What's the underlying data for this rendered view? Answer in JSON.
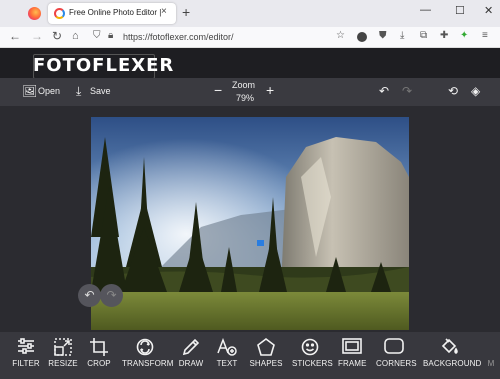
{
  "browser": {
    "tab_title": "Free Online Photo Editor | Fotof",
    "tab_close": "×",
    "new_tab": "+",
    "url": "https://fotoflexer.com/editor/",
    "window_controls": {
      "minimize": "—",
      "maximize": "☐",
      "close": "✕"
    }
  },
  "app": {
    "logo_text": "FOTOFLEXER",
    "toolbar": {
      "open_label": "Open",
      "save_label": "Save",
      "zoom_label": "Zoom",
      "zoom_value": "79%",
      "zoom_out": "−",
      "zoom_in": "+"
    },
    "tools": [
      {
        "label": "FILTER",
        "icon": "sliders-icon"
      },
      {
        "label": "RESIZE",
        "icon": "resize-icon"
      },
      {
        "label": "CROP",
        "icon": "crop-icon"
      },
      {
        "label": "TRANSFORM",
        "icon": "transform-icon"
      },
      {
        "label": "DRAW",
        "icon": "pencil-icon"
      },
      {
        "label": "TEXT",
        "icon": "text-icon"
      },
      {
        "label": "SHAPES",
        "icon": "shapes-icon"
      },
      {
        "label": "STICKERS",
        "icon": "smiley-icon"
      },
      {
        "label": "FRAME",
        "icon": "frame-icon"
      },
      {
        "label": "CORNERS",
        "icon": "corners-icon"
      },
      {
        "label": "BACKGROUND",
        "icon": "paint-bucket-icon"
      },
      {
        "label": "M",
        "icon": ""
      }
    ]
  },
  "colors": {
    "app_background": "#2b2b30",
    "toolbar": "#3a3a40",
    "header": "#1e1e22",
    "bottombar": "#38383e",
    "text": "#f2f2f2"
  }
}
